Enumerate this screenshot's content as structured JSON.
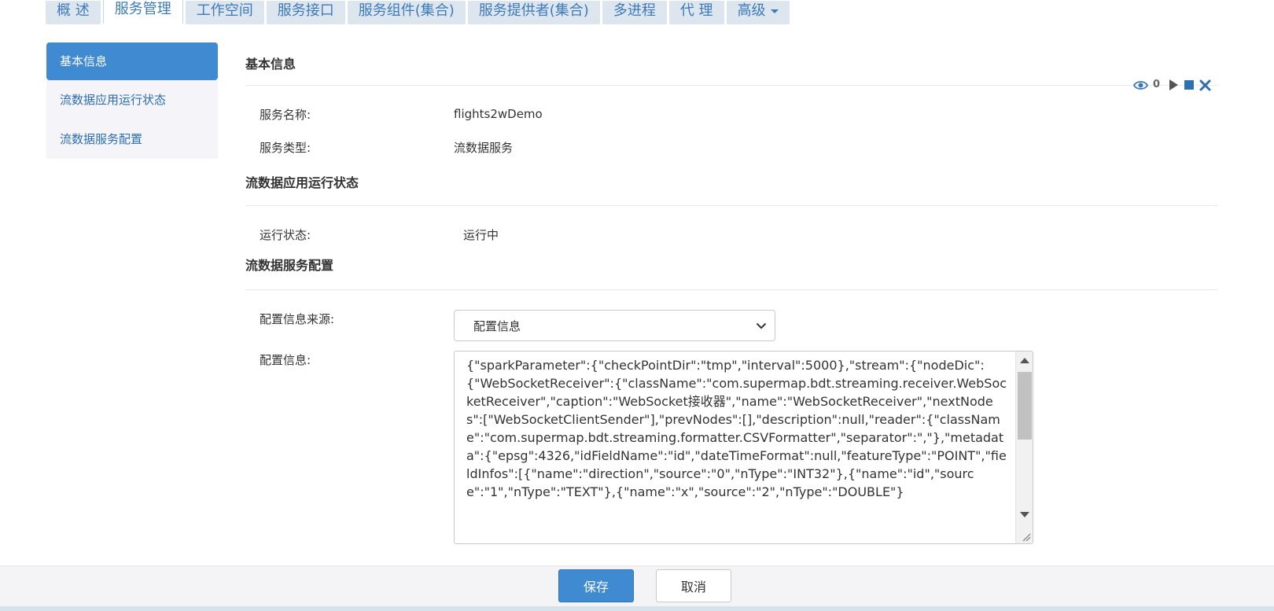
{
  "tabs": [
    {
      "label": "概 述",
      "active": false
    },
    {
      "label": "服务管理",
      "active": true
    },
    {
      "label": "工作空间",
      "active": false
    },
    {
      "label": "服务接口",
      "active": false
    },
    {
      "label": "服务组件(集合)",
      "active": false
    },
    {
      "label": "服务提供者(集合)",
      "active": false
    },
    {
      "label": "多进程",
      "active": false
    },
    {
      "label": "代 理",
      "active": false
    },
    {
      "label": "高级",
      "active": false,
      "dropdown": true
    }
  ],
  "sidenav": {
    "items": [
      {
        "label": "基本信息",
        "active": true
      },
      {
        "label": "流数据应用运行状态",
        "active": false
      },
      {
        "label": "流数据服务配置",
        "active": false
      }
    ]
  },
  "toolbar": {
    "view_count": "0"
  },
  "basic": {
    "title": "基本信息",
    "name_label": "服务名称:",
    "name_value": "flights2wDemo",
    "type_label": "服务类型:",
    "type_value": "流数据服务"
  },
  "status": {
    "title": "流数据应用运行状态",
    "run_label": "运行状态:",
    "run_value": "运行中"
  },
  "config": {
    "title": "流数据服务配置",
    "source_label": "配置信息来源:",
    "source_value": "配置信息",
    "info_label": "配置信息:",
    "info_text": "{\"sparkParameter\":{\"checkPointDir\":\"tmp\",\"interval\":5000},\"stream\":{\"nodeDic\":{\"WebSocketReceiver\":{\"className\":\"com.supermap.bdt.streaming.receiver.WebSocketReceiver\",\"caption\":\"WebSocket接收器\",\"name\":\"WebSocketReceiver\",\"nextNodes\":[\"WebSocketClientSender\"],\"prevNodes\":[],\"description\":null,\"reader\":{\"className\":\"com.supermap.bdt.streaming.formatter.CSVFormatter\",\"separator\":\",\"},\"metadata\":{\"epsg\":4326,\"idFieldName\":\"id\",\"dateTimeFormat\":null,\"featureType\":\"POINT\",\"fieldInfos\":[{\"name\":\"direction\",\"source\":\"0\",\"nType\":\"INT32\"},{\"name\":\"id\",\"source\":\"1\",\"nType\":\"TEXT\"},{\"name\":\"x\",\"source\":\"2\",\"nType\":\"DOUBLE\"}"
  },
  "footer": {
    "save_label": "保存",
    "cancel_label": "取消"
  },
  "colors": {
    "accent": "#3f8ad0",
    "link": "#2b6db3",
    "tab_bg": "#dde6ef"
  }
}
